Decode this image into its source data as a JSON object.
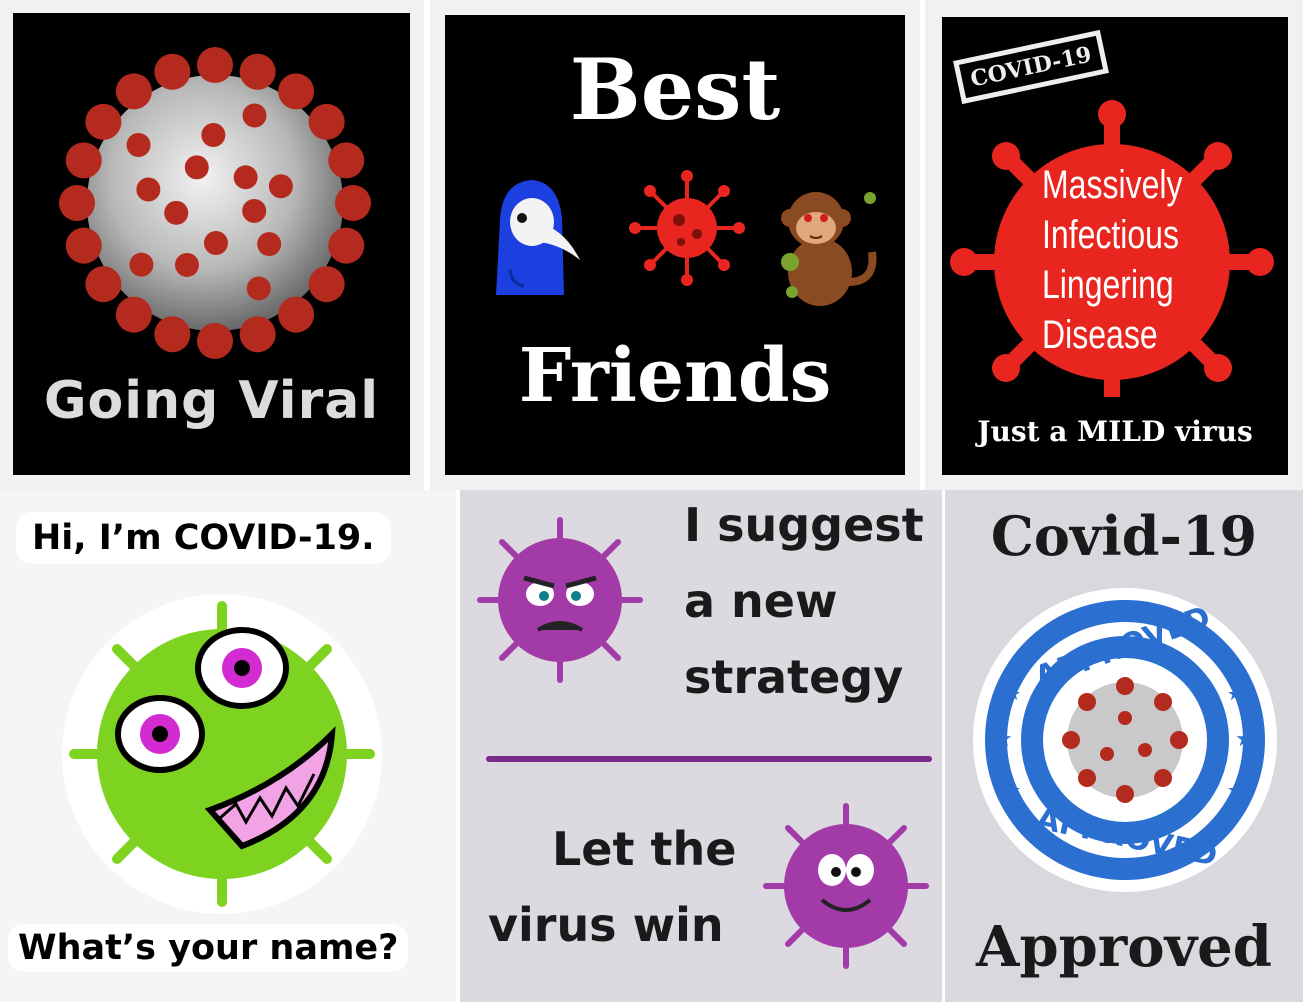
{
  "tiles": {
    "going_viral": {
      "caption": "Going Viral"
    },
    "best_friends": {
      "line1": "Best",
      "line2": "Friends"
    },
    "mild": {
      "stamp": "COVID-19",
      "lines": [
        "Massively",
        "Infectious",
        "Lingering",
        "Disease"
      ],
      "footer": "Just a MILD virus"
    },
    "hi_covid": {
      "top": "Hi, I’m COVID-19.",
      "bottom": "What’s your name?"
    },
    "strategy": {
      "line1": "I suggest",
      "line2": "a new",
      "line3": "strategy",
      "line4": "Let the",
      "line5": "virus win"
    },
    "approved": {
      "title": "Covid-19",
      "seal_top": "APPROVED",
      "seal_bottom": "APPROVED",
      "bottom": "Approved"
    }
  },
  "colors": {
    "virus_red": "#b52a1e",
    "virus_bright_red": "#e8261f",
    "spike_grey": "#cfcfcf",
    "green_virus": "#7ed321",
    "purple_virus": "#a23aa8",
    "seal_blue": "#2b6fd0",
    "plague_blue": "#1c3fe0",
    "monkey_brown": "#8a4a22"
  },
  "icons": [
    "coronavirus-illustration",
    "plague-doctor-icon",
    "virus-icon",
    "monkey-icon",
    "green-virus-character",
    "angry-purple-virus",
    "happy-purple-virus",
    "approved-seal"
  ]
}
